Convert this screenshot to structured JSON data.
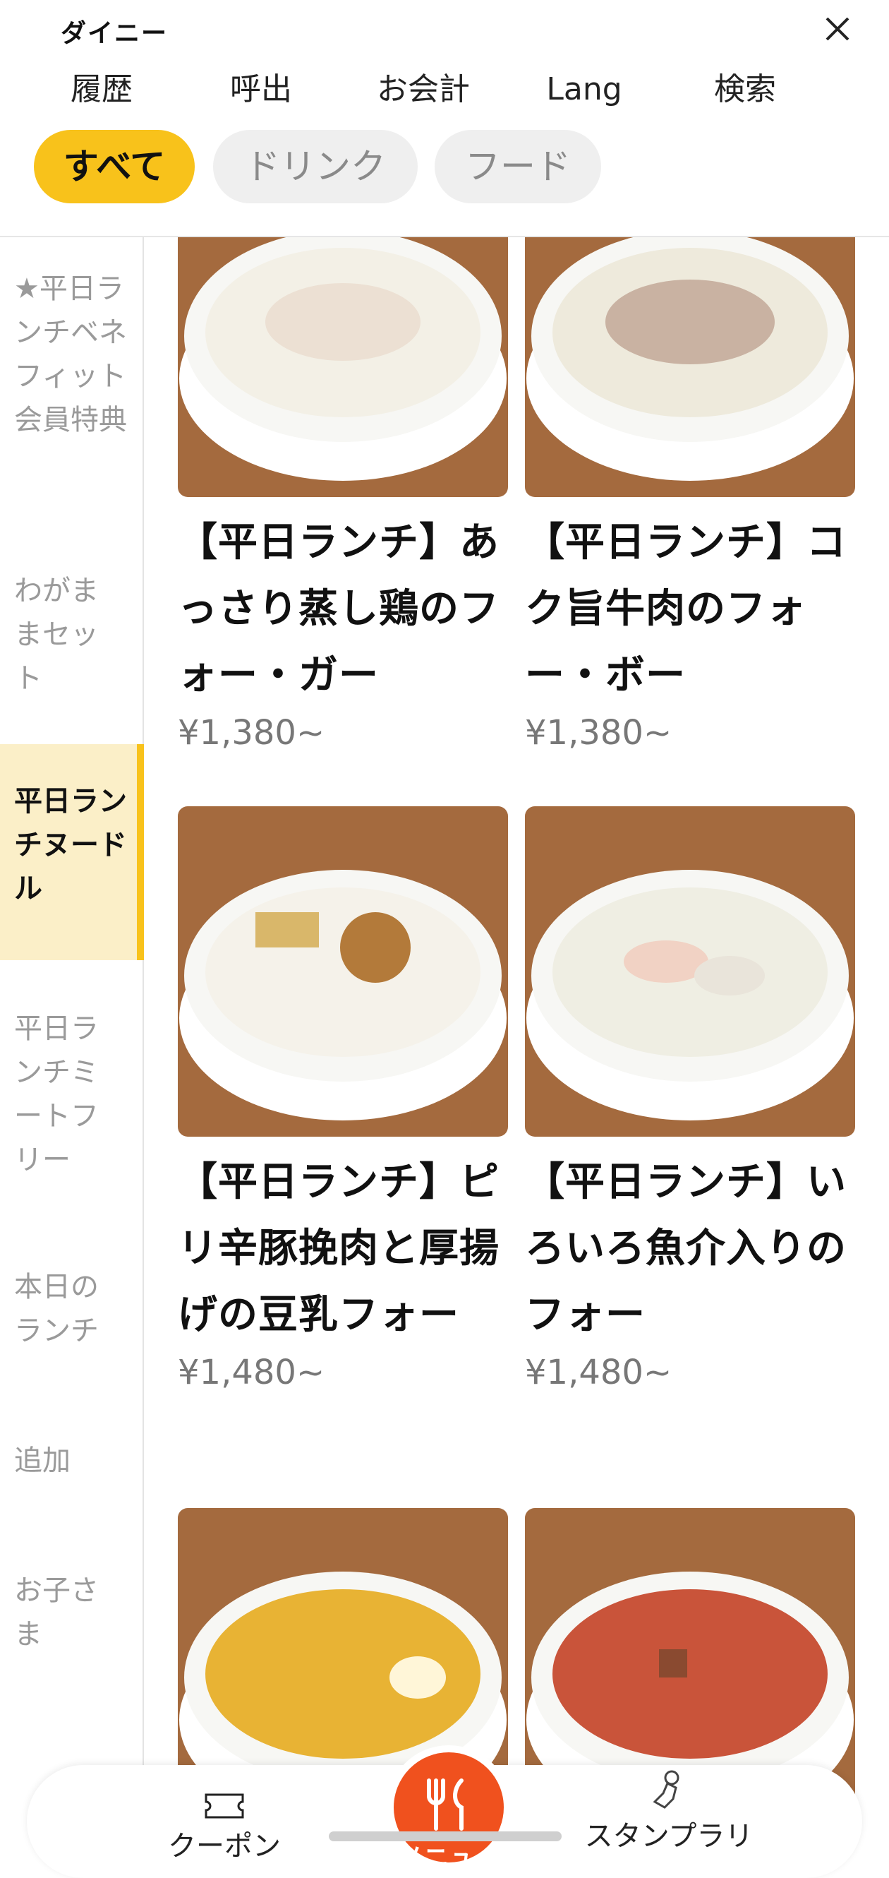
{
  "app": {
    "title": "ダイニー"
  },
  "topnav": [
    "履歴",
    "呼出",
    "お会計",
    "Lang",
    "検索"
  ],
  "chips": [
    {
      "label": "すべて",
      "active": true
    },
    {
      "label": "ドリンク",
      "active": false
    },
    {
      "label": "フード",
      "active": false
    }
  ],
  "categories": [
    {
      "label": "★平日ランチベネフィット会員特典",
      "active": false
    },
    {
      "label": "わがままセット",
      "active": false
    },
    {
      "label": "平日ランチヌードル",
      "active": true
    },
    {
      "label": "平日ランチミートフリー",
      "active": false
    },
    {
      "label": "本日のランチ",
      "active": false
    },
    {
      "label": "追加",
      "active": false
    },
    {
      "label": "お子さま",
      "active": false
    }
  ],
  "items": [
    {
      "name": "【平日ランチ】あっさり蒸し鶏のフォー・ガー",
      "price": "¥1,380~",
      "soup": "#f3f0e6"
    },
    {
      "name": "【平日ランチ】コク旨牛肉のフォー・ボー",
      "price": "¥1,380~",
      "soup": "#eeeadc"
    },
    {
      "name": "【平日ランチ】ピリ辛豚挽肉と厚揚げの豆乳フォー",
      "price": "¥1,480~",
      "soup": "#f5f2ea"
    },
    {
      "name": "【平日ランチ】いろいろ魚介入りのフォー",
      "price": "¥1,480~",
      "soup": "#efeee3"
    },
    {
      "name": "",
      "price": "",
      "soup": "#e8b334"
    },
    {
      "name": "",
      "price": "",
      "soup": "#c9543a"
    }
  ],
  "tabbar": {
    "coupon": "クーポン",
    "menu": "メニュー",
    "stamp": "スタンプラリ"
  },
  "colors": {
    "accent": "#f8c21b",
    "fab": "#f0511e",
    "wood": "#a46a3e"
  },
  "icons": [
    "close-icon",
    "ticket-icon",
    "fork-knife-icon",
    "stamp-icon"
  ]
}
